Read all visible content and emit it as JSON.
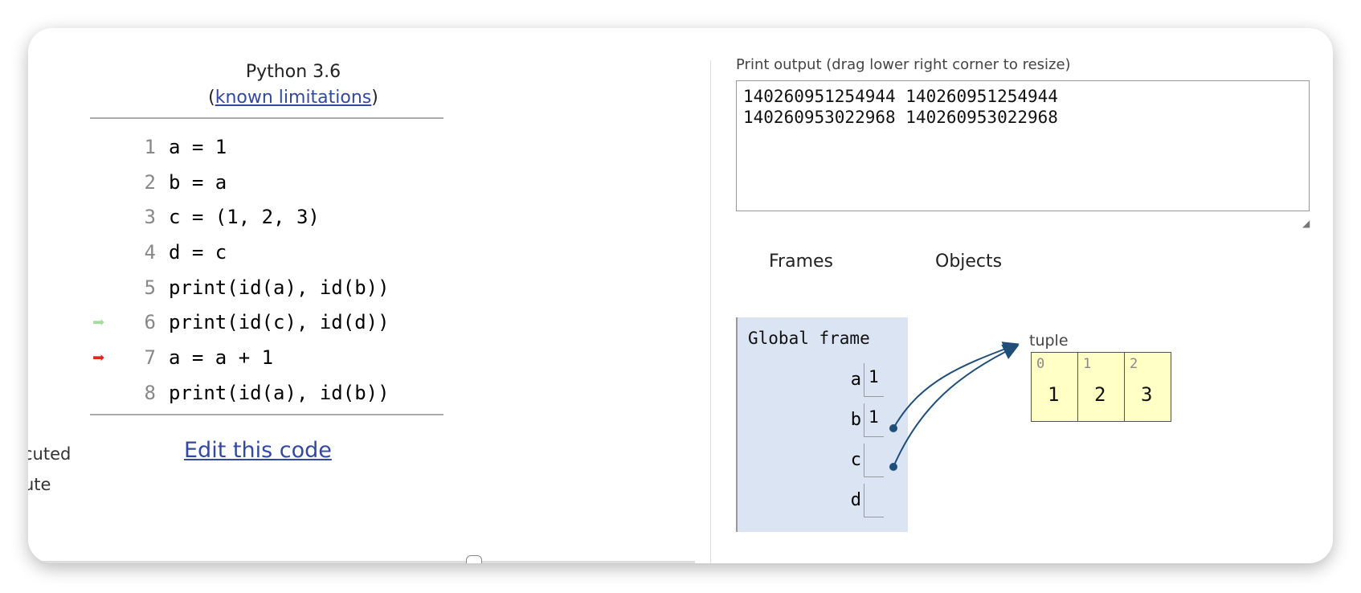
{
  "editor": {
    "title": "Python 3.6",
    "limits_open": "(",
    "limits_link": "known limitations",
    "limits_close": ")",
    "lines": [
      {
        "num": "1",
        "code": "a = 1",
        "marker": ""
      },
      {
        "num": "2",
        "code": "b = a",
        "marker": ""
      },
      {
        "num": "3",
        "code": "c = (1, 2, 3)",
        "marker": ""
      },
      {
        "num": "4",
        "code": "d = c",
        "marker": ""
      },
      {
        "num": "5",
        "code": "print(id(a), id(b))",
        "marker": ""
      },
      {
        "num": "6",
        "code": "print(id(c), id(d))",
        "marker": "just-executed"
      },
      {
        "num": "7",
        "code": "a = a + 1",
        "marker": "next"
      },
      {
        "num": "8",
        "code": "print(id(a), id(b))",
        "marker": ""
      }
    ],
    "edit_link": "Edit this code",
    "legend_partial_1": "cuted",
    "legend_partial_2": "ute",
    "colors": {
      "just_executed": "#a6dba0",
      "next": "#e0241c",
      "link": "#3348a0"
    }
  },
  "output": {
    "label": "Print output (drag lower right corner to resize)",
    "text": "140260951254944 140260951254944\n140260953022968 140260953022968"
  },
  "viz": {
    "frames_header": "Frames",
    "objects_header": "Objects",
    "frame_name": "Global frame",
    "variables": [
      {
        "name": "a",
        "value": "1"
      },
      {
        "name": "b",
        "value": "1"
      },
      {
        "name": "c",
        "value": "",
        "pointer": "tuple"
      },
      {
        "name": "d",
        "value": "",
        "pointer": "tuple"
      }
    ],
    "tuple": {
      "label": "tuple",
      "indices": [
        "0",
        "1",
        "2"
      ],
      "values": [
        "1",
        "2",
        "3"
      ]
    },
    "colors": {
      "frame_bg": "#dae4f3",
      "object_bg": "#ffffc6",
      "pointer": "#1f4e79"
    }
  }
}
